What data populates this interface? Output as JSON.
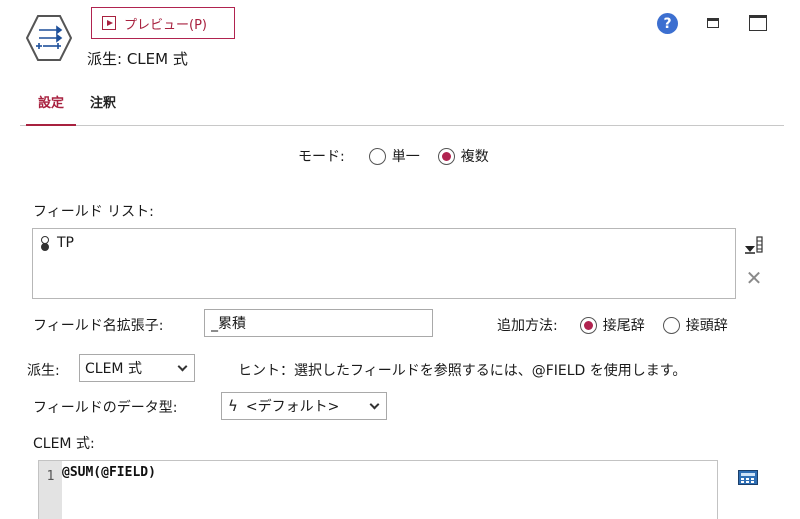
{
  "header": {
    "preview_label": "プレビュー(P)",
    "node_title": "派生: CLEM 式",
    "icons": {
      "node": "derive-node-icon",
      "help": "help-icon",
      "minimize": "minimize-icon",
      "maximize": "maximize-icon",
      "help_glyph": "?"
    },
    "accent_color": "#a8213f"
  },
  "tabs": [
    {
      "label": "設定",
      "active": true
    },
    {
      "label": "注釈",
      "active": false
    }
  ],
  "mode": {
    "label": "モード:",
    "options": [
      {
        "label": "単一",
        "selected": false
      },
      {
        "label": "複数",
        "selected": true
      }
    ]
  },
  "field_list": {
    "label": "フィールド リスト:",
    "items": [
      {
        "name": "TP",
        "icon": "continuous-measure-icon"
      }
    ]
  },
  "extension": {
    "label": "フィールド名拡張子:",
    "value": "_累積"
  },
  "add_method": {
    "label": "追加方法:",
    "options": [
      {
        "label": "接尾辞",
        "selected": true
      },
      {
        "label": "接頭辞",
        "selected": false
      }
    ]
  },
  "derive": {
    "label": "派生:",
    "selected": "CLEM 式",
    "hint": "ヒント：選択したフィールドを参照するには、@FIELD を使用します。"
  },
  "field_type": {
    "label": "フィールドのデータ型:",
    "selected": "<デフォルト>"
  },
  "clem": {
    "label": "CLEM 式:",
    "lines": [
      {
        "number": "1",
        "text": "@SUM(@FIELD)"
      }
    ]
  }
}
